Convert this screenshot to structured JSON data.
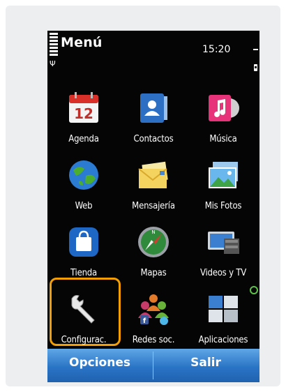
{
  "status_bar": {
    "title": "Menú",
    "time": "15:20"
  },
  "apps": [
    {
      "label": "Agenda",
      "icon": "calendar-icon",
      "date": "12"
    },
    {
      "label": "Contactos",
      "icon": "contacts-icon"
    },
    {
      "label": "Música",
      "icon": "music-icon"
    },
    {
      "label": "Web",
      "icon": "globe-icon"
    },
    {
      "label": "Mensajería",
      "icon": "envelope-icon"
    },
    {
      "label": "Mis Fotos",
      "icon": "photos-icon"
    },
    {
      "label": "Tienda",
      "icon": "store-bag-icon"
    },
    {
      "label": "Mapas",
      "icon": "compass-icon"
    },
    {
      "label": "Videos y TV",
      "icon": "tv-icon"
    },
    {
      "label": "Configurac.",
      "icon": "wrench-icon",
      "selected": true
    },
    {
      "label": "Redes soc.",
      "icon": "social-networks-icon"
    },
    {
      "label": "Aplicaciones",
      "icon": "applications-folder-icon"
    }
  ],
  "softkeys": {
    "left": "Opciones",
    "right": "Salir"
  },
  "colors": {
    "softbar": "#2a74c6",
    "selection": "#f29f05"
  }
}
